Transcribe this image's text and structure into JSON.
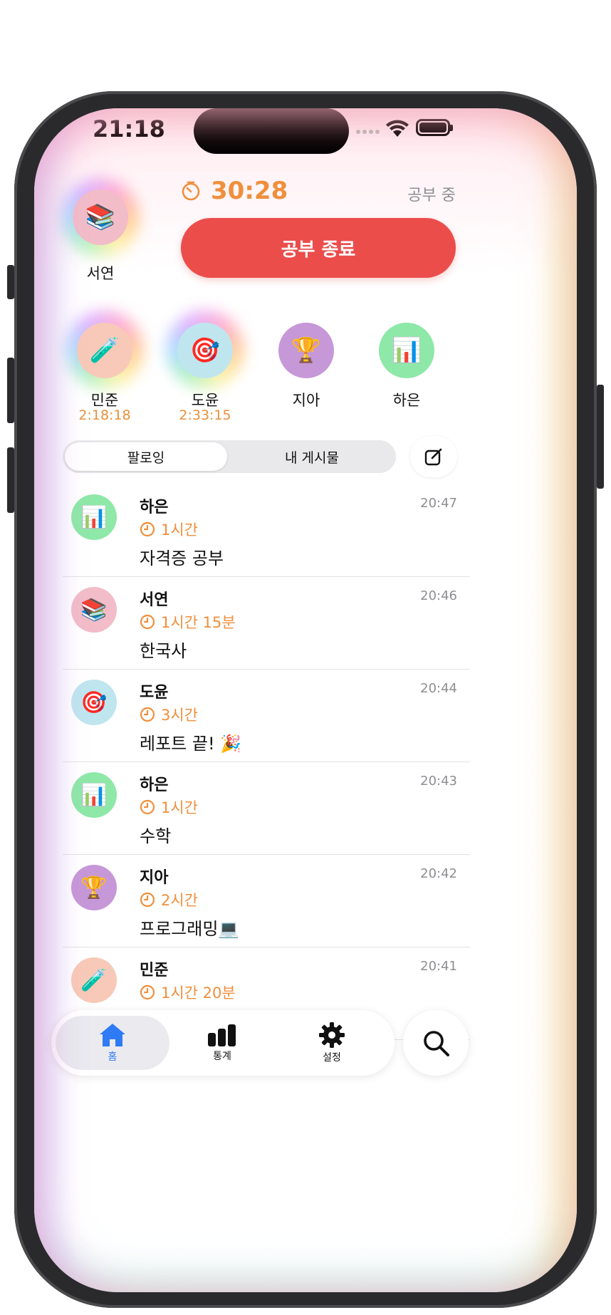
{
  "status_bar": {
    "time": "21:18"
  },
  "me": {
    "name": "서연",
    "emoji": "📚",
    "avatar_color": "#f2bcc8"
  },
  "timer": {
    "elapsed": "30:28",
    "state": "공부 중",
    "stop_label": "공부 종료"
  },
  "friends": [
    {
      "name": "민준",
      "emoji": "🧪",
      "study_time": "2:18:18",
      "avatar_color": "#f8c9b8",
      "active": true
    },
    {
      "name": "도윤",
      "emoji": "🎯",
      "study_time": "2:33:15",
      "avatar_color": "#bfe6ef",
      "active": true
    },
    {
      "name": "지아",
      "emoji": "🏆",
      "study_time": "",
      "avatar_color": "#c698d8",
      "active": false
    },
    {
      "name": "하은",
      "emoji": "📊",
      "study_time": "",
      "avatar_color": "#8ee8a8",
      "active": false
    }
  ],
  "segment": {
    "tabs": [
      "팔로잉",
      "내 게시물"
    ],
    "selected": 0
  },
  "feed": [
    {
      "user": "하은",
      "emoji": "📊",
      "avatar_color": "#8ee8a8",
      "duration": "1시간",
      "text": "자격증 공부",
      "time": "20:47"
    },
    {
      "user": "서연",
      "emoji": "📚",
      "avatar_color": "#f2bcc8",
      "duration": "1시간 15분",
      "text": "한국사",
      "time": "20:46"
    },
    {
      "user": "도윤",
      "emoji": "🎯",
      "avatar_color": "#bfe6ef",
      "duration": "3시간",
      "text": "레포트 끝! 🎉",
      "time": "20:44"
    },
    {
      "user": "하은",
      "emoji": "📊",
      "avatar_color": "#8ee8a8",
      "duration": "1시간",
      "text": "수학",
      "time": "20:43"
    },
    {
      "user": "지아",
      "emoji": "🏆",
      "avatar_color": "#c698d8",
      "duration": "2시간",
      "text": "프로그래밍💻",
      "time": "20:42"
    },
    {
      "user": "민준",
      "emoji": "🧪",
      "avatar_color": "#f8c9b8",
      "duration": "1시간 20분",
      "text": "",
      "time": "20:41"
    }
  ],
  "tabbar": {
    "tabs": [
      {
        "label": "홈",
        "icon": "house-icon",
        "active": true
      },
      {
        "label": "통계",
        "icon": "bar-chart-icon",
        "active": false
      },
      {
        "label": "설정",
        "icon": "gear-icon",
        "active": false
      }
    ],
    "search_icon": "magnifier-icon"
  },
  "colors": {
    "accent_orange": "#ef8f3c",
    "stop_red": "#eb4d4b",
    "tab_active_blue": "#2f7bf5"
  }
}
